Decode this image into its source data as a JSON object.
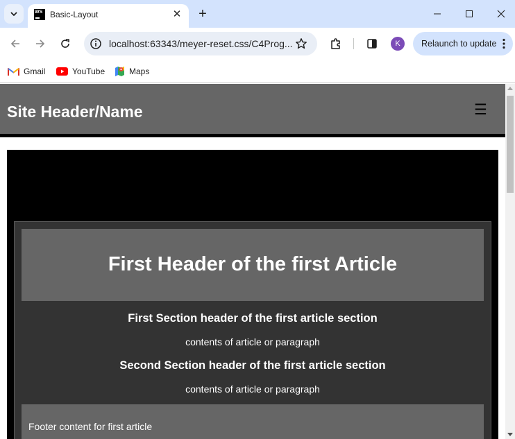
{
  "browser": {
    "tab_title": "Basic-Layout",
    "tab_favicon_text": "WS",
    "url": "localhost:63343/meyer-reset.css/C4Prog...",
    "profile_initial": "K",
    "relaunch_label": "Relaunch to update",
    "bookmarks": [
      {
        "label": "Gmail",
        "icon": "gmail-icon"
      },
      {
        "label": "YouTube",
        "icon": "youtube-icon"
      },
      {
        "label": "Maps",
        "icon": "maps-icon"
      }
    ]
  },
  "page": {
    "site_title": "Site Header/Name",
    "menu_glyph": "☰",
    "article": {
      "title": "First Header of the first Article",
      "sections": [
        {
          "heading": "First Section header of the first article section",
          "body": "contents of article or paragraph"
        },
        {
          "heading": "Second Section header of the first article section",
          "body": "contents of article or paragraph"
        }
      ],
      "footer": "Footer content for first article"
    }
  },
  "colors": {
    "chrome_bg": "#d3e3fd",
    "header_bg": "#666666",
    "main_bg": "#000000",
    "article_bg": "#333333"
  }
}
